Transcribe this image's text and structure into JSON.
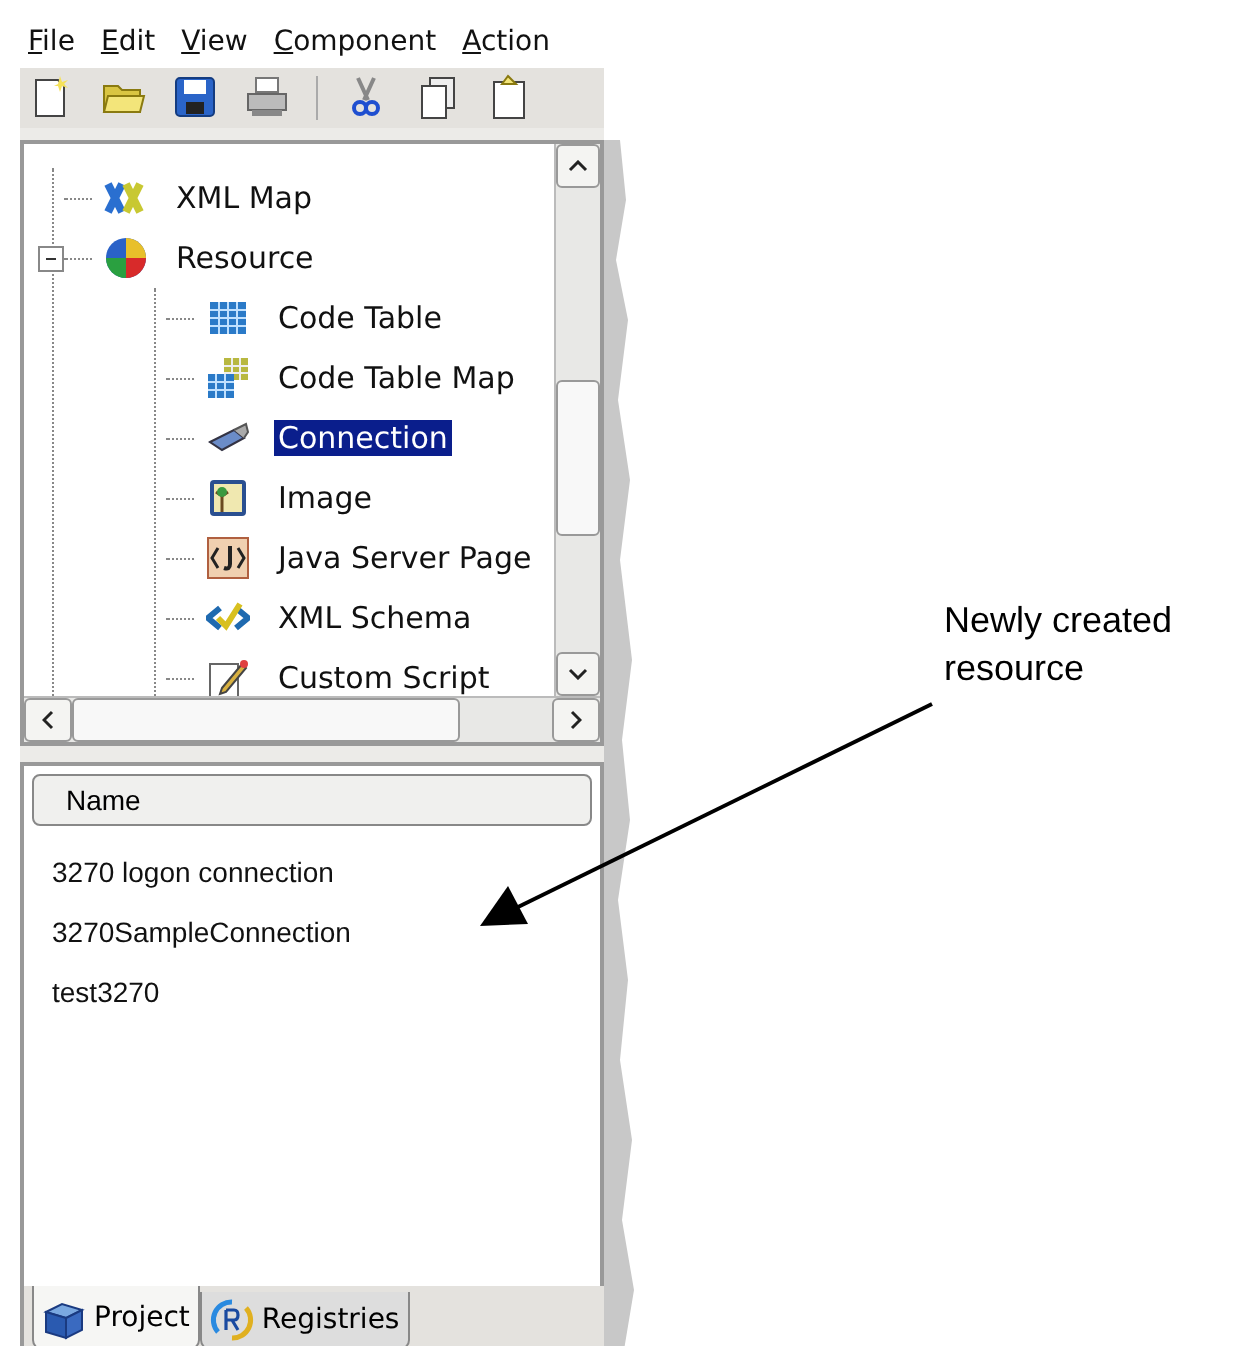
{
  "menu_bar": [
    "File",
    "Edit",
    "View",
    "Component",
    "Action"
  ],
  "tree": [
    {
      "label": "XML Map",
      "selected": false
    },
    {
      "label": "Resource",
      "selected": false,
      "expanded": true,
      "children": [
        {
          "label": "Code Table",
          "selected": false
        },
        {
          "label": "Code Table Map",
          "selected": false
        },
        {
          "label": "Connection",
          "selected": true
        },
        {
          "label": "Image",
          "selected": false
        },
        {
          "label": "Java Server Page",
          "selected": false
        },
        {
          "label": "XML Schema",
          "selected": false
        },
        {
          "label": "Custom Script",
          "selected": false
        }
      ]
    }
  ],
  "list": {
    "columns": [
      "Name"
    ],
    "rows": [
      "3270 logon connection",
      "3270SampleConnection",
      "test3270"
    ]
  },
  "tabs": [
    {
      "label": "Project",
      "selected": true
    },
    {
      "label": "Registries",
      "selected": false
    }
  ],
  "annotation": {
    "text": "Newly created resource"
  }
}
